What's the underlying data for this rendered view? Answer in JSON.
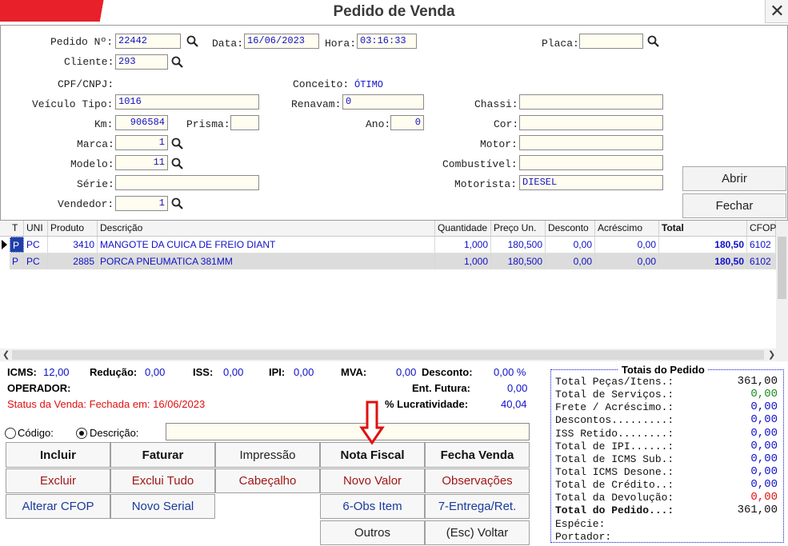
{
  "window": {
    "title": "Pedido de Venda",
    "close_glyph": "✕"
  },
  "form": {
    "pedido_label": "Pedido Nº:",
    "pedido_value": "22442",
    "data_label": "Data:",
    "data_value": "16/06/2023",
    "hora_label": "Hora:",
    "hora_value": "03:16:33",
    "placa_label": "Placa:",
    "placa_value": "",
    "cliente_label": "Cliente:",
    "cliente_value": "293",
    "cpf_label": "CPF/CNPJ:",
    "conceito_label": "Conceito:",
    "conceito_value": "ÓTIMO",
    "veiculo_tipo_label": "Veículo Tipo:",
    "veiculo_tipo_value": "1016",
    "renavam_label": "Renavam:",
    "renavam_value": "0",
    "chassi_label": "Chassi:",
    "chassi_value": "",
    "km_label": "Km:",
    "km_value": "906584",
    "prisma_label": "Prisma:",
    "prisma_value": "",
    "ano_label": "Ano:",
    "ano_value": "0",
    "cor_label": "Cor:",
    "cor_value": "",
    "marca_label": "Marca:",
    "marca_value": "1",
    "motor_label": "Motor:",
    "motor_value": "",
    "modelo_label": "Modelo:",
    "modelo_value": "11",
    "combustivel_label": "Combustível:",
    "combustivel_value": "",
    "serie_label": "Série:",
    "serie_value": "",
    "motorista_label": "Motorista:",
    "motorista_value": "DIESEL",
    "vendedor_label": "Vendedor:",
    "vendedor_value": "1",
    "abrir_label": "Abrir",
    "fechar_label": "Fechar"
  },
  "grid": {
    "columns": [
      "T",
      "UNI",
      "Produto",
      "Descrição",
      "Quantidade",
      "Preço Un.",
      "Desconto",
      "Acréscimo",
      "Total",
      "CFOP"
    ],
    "rows": [
      {
        "t": "P",
        "uni": "PC",
        "produto": "3410",
        "descricao": "MANGOTE DA CUICA DE FREIO DIANT",
        "quantidade": "1,000",
        "preco": "180,500",
        "desconto": "0,00",
        "acrescimo": "0,00",
        "total": "180,50",
        "cfop": "6102"
      },
      {
        "t": "P",
        "uni": "PC",
        "produto": "2885",
        "descricao": "PORCA PNEUMATICA 381MM",
        "quantidade": "1,000",
        "preco": "180,500",
        "desconto": "0,00",
        "acrescimo": "0,00",
        "total": "180,50",
        "cfop": "6102"
      }
    ]
  },
  "summary": {
    "icms_label": "ICMS:",
    "icms_value": "12,00",
    "reducao_label": "Redução:",
    "reducao_value": "0,00",
    "iss_label": "ISS:",
    "iss_value": "0,00",
    "ipi_label": "IPI:",
    "ipi_value": "0,00",
    "mva_label": "MVA:",
    "mva_value": "0,00",
    "desconto_label": "Desconto:",
    "desconto_value": "0,00 %",
    "operador_label": "OPERADOR:",
    "ent_futura_label": "Ent. Futura:",
    "ent_futura_value": "0,00",
    "status_text": "Status da Venda: Fechada em: 16/06/2023",
    "lucratividade_label": "% Lucratividade:",
    "lucratividade_value": "40,04",
    "codigo_label": "Código:",
    "descricao_label": "Descrição:",
    "search_value": ""
  },
  "actions": {
    "incluir": "Incluir",
    "faturar": "Faturar",
    "impressao": "Impressão",
    "nota_fiscal": "Nota Fiscal",
    "fecha_venda": "Fecha Venda",
    "excluir": "Excluir",
    "exclui_tudo": "Exclui Tudo",
    "cabecalho": "Cabeçalho",
    "novo_valor": "Novo Valor",
    "observacoes": "Observações",
    "alterar_cfop": "Alterar CFOP",
    "novo_serial": "Novo Serial",
    "obs_item": "6-Obs Item",
    "entrega_ret": "7-Entrega/Ret.",
    "outros": "Outros",
    "esc_voltar": "(Esc) Voltar"
  },
  "totals": {
    "title": "Totais do Pedido",
    "items": [
      {
        "label": "Total Peças/Itens.:",
        "value": "361,00",
        "color": "#111111"
      },
      {
        "label": "Total de Serviços.:",
        "value": "0,00",
        "color": "#1a8a1a"
      },
      {
        "label": "Frete / Acréscimo.:",
        "value": "0,00",
        "color": "#1010c8"
      },
      {
        "label": "Descontos.........:",
        "value": "0,00",
        "color": "#1010c8"
      },
      {
        "label": "ISS Retido........:",
        "value": "0,00",
        "color": "#1010c8"
      },
      {
        "label": "Total de IPI......:",
        "value": "0,00",
        "color": "#1010c8"
      },
      {
        "label": "Total de ICMS Sub.:",
        "value": "0,00",
        "color": "#1010c8"
      },
      {
        "label": "Total ICMS Desone.:",
        "value": "0,00",
        "color": "#1010c8"
      },
      {
        "label": "Total de Crédito..:",
        "value": "0,00",
        "color": "#1010c8"
      },
      {
        "label": "Total da Devolução:",
        "value": "0,00",
        "color": "#e01010"
      },
      {
        "label": "Total do Pedido...:",
        "value": "361,00",
        "color": "#111111"
      }
    ],
    "especie_label": "Espécie:",
    "portador_label": "Portador:"
  },
  "annotation": {
    "arrow_color": "#e01010"
  }
}
